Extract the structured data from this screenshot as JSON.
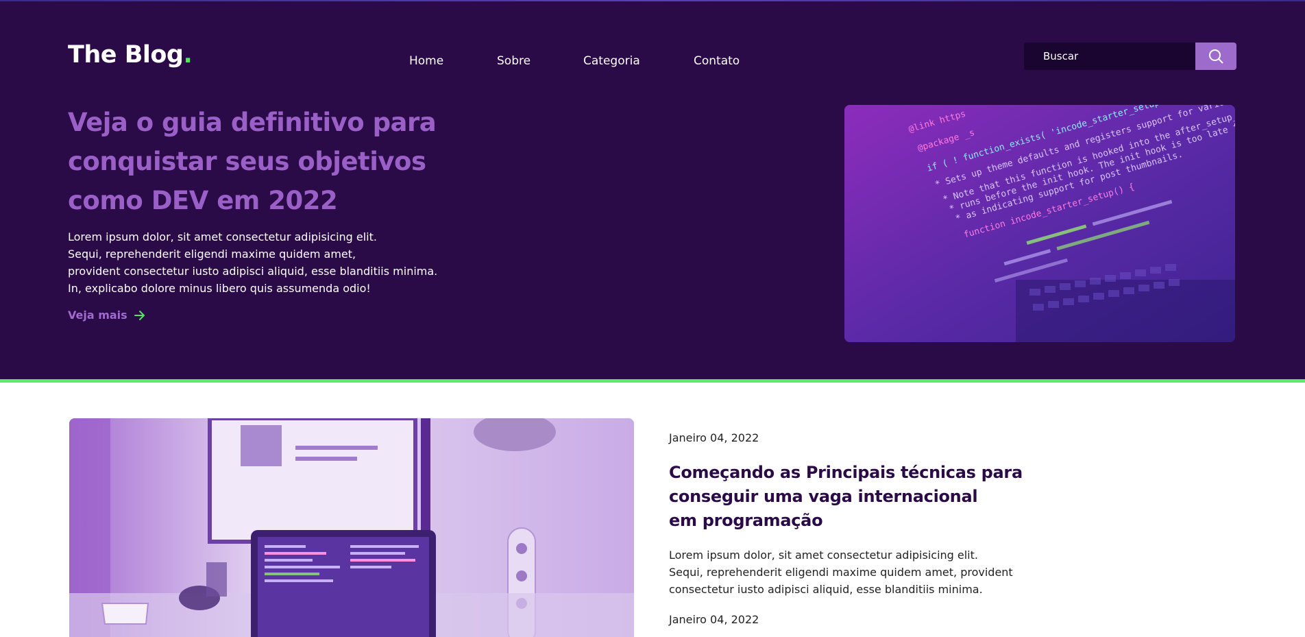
{
  "header": {
    "logo_text": "The Blog",
    "logo_dot": "."
  },
  "nav": {
    "items": [
      {
        "label": "Home"
      },
      {
        "label": "Sobre"
      },
      {
        "label": "Categoria"
      },
      {
        "label": "Contato"
      }
    ]
  },
  "search": {
    "placeholder": "Buscar",
    "icon": "search-icon"
  },
  "hero": {
    "title_lines": [
      "Veja o guia definitivo para",
      "conquistar seus objetivos",
      "como DEV em 2022"
    ],
    "text_lines": [
      "Lorem ipsum dolor, sit amet consectetur adipisicing elit.",
      "Sequi, reprehenderit eligendi maxime quidem amet,",
      "provident consectetur iusto adipisci aliquid, esse blanditiis minima.",
      "In, explicabo dolore minus libero quis assumenda odio!"
    ],
    "link_label": "Veja mais",
    "link_icon": "arrow-right-icon",
    "image_code_lines": [
      "@link https",
      "@package _s",
      "if ( ! function_exists( 'incode_starter_setup' ) ) :",
      "* Sets up theme defaults and registers support for various",
      "* Note that this function is hooked into the after_setup_theme hook",
      "* runs before the init hook. The init hook is too late for some",
      "* as indicating support for post thumbnails.",
      "function incode_starter_setup() {"
    ]
  },
  "post": {
    "date_1": "Janeiro 04, 2022",
    "title_lines": [
      "Começando as Principais técnicas para",
      "conseguir uma vaga internacional",
      "em programação"
    ],
    "text_lines": [
      "Lorem ipsum dolor, sit amet consectetur adipisicing elit.",
      "Sequi, reprehenderit eligendi maxime quidem amet, provident",
      "consectetur iusto adipisci aliquid, esse blanditiis minima."
    ],
    "date_2": "Janeiro 04, 2022"
  },
  "colors": {
    "hero_bg": "#2a0a47",
    "accent_purple": "#9a60c8",
    "accent_green": "#5bea6a",
    "title_dark": "#2a0a47"
  }
}
